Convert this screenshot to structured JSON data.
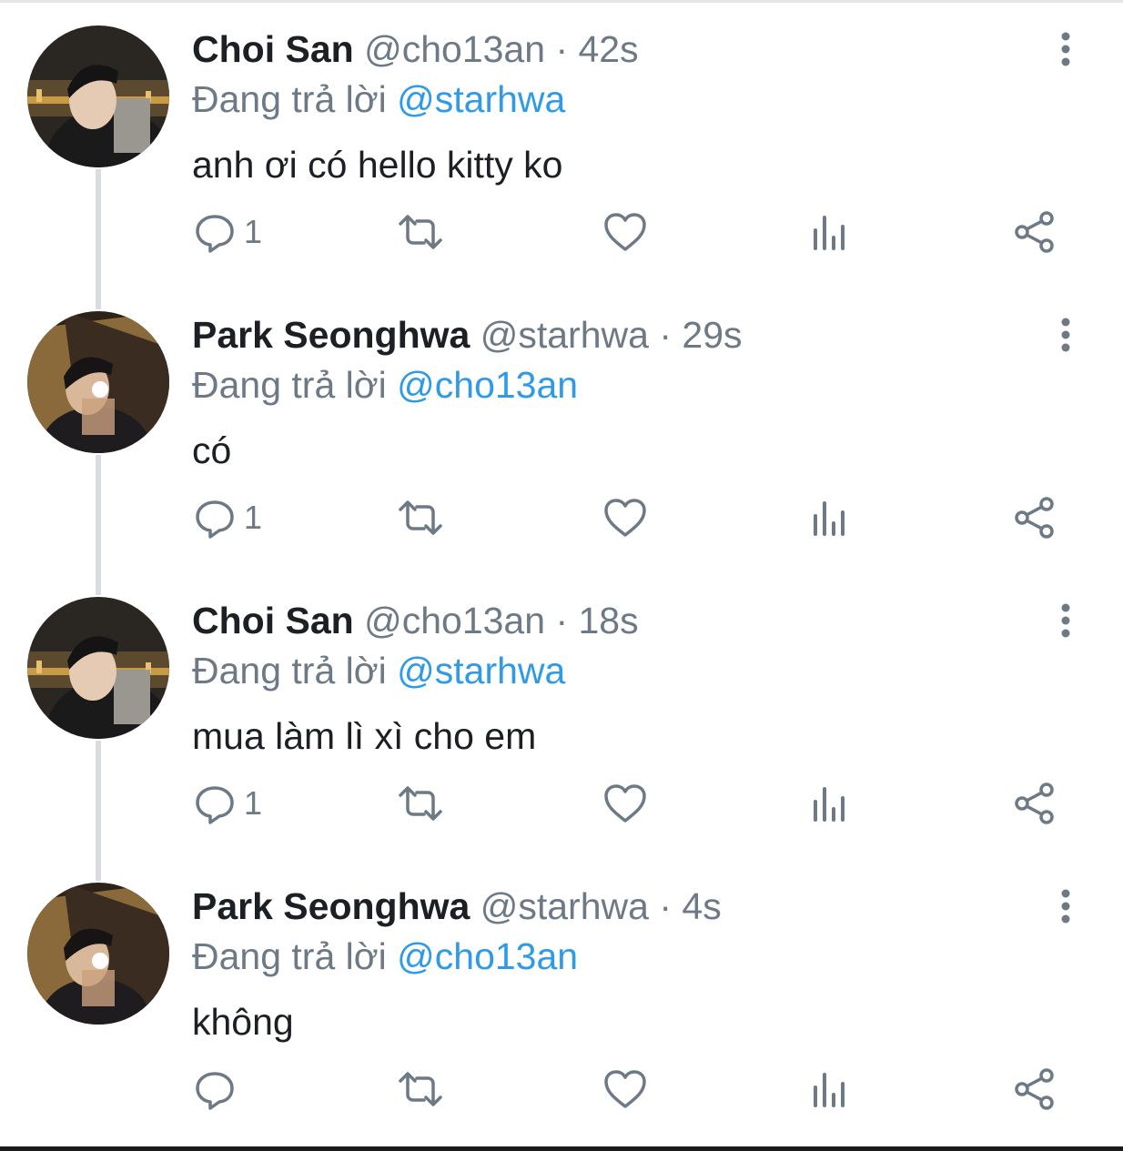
{
  "colors": {
    "text": "#1c1f23",
    "secondary": "#6d7a86",
    "link": "#2f9be6",
    "thread_line": "#d9dde1"
  },
  "icons": {
    "reply": "reply-icon",
    "retweet": "retweet-icon",
    "like": "like-icon",
    "views": "views-icon",
    "share": "share-icon",
    "more": "more-options-icon"
  },
  "tweets": [
    {
      "name": "Choi San",
      "handle": "@cho13an",
      "separator": "·",
      "time": "42s",
      "reply_prefix": "Đang trả lời",
      "reply_to": "@starhwa",
      "text": "anh ơi có hello kitty ko",
      "reply_count": "1"
    },
    {
      "name": "Park Seonghwa",
      "handle": "@starhwa",
      "separator": "·",
      "time": "29s",
      "reply_prefix": "Đang trả lời",
      "reply_to": "@cho13an",
      "text": "có",
      "reply_count": "1"
    },
    {
      "name": "Choi San",
      "handle": "@cho13an",
      "separator": "·",
      "time": "18s",
      "reply_prefix": "Đang trả lời",
      "reply_to": "@starhwa",
      "text": "mua làm lì xì cho em",
      "reply_count": "1"
    },
    {
      "name": "Park Seonghwa",
      "handle": "@starhwa",
      "separator": "·",
      "time": "4s",
      "reply_prefix": "Đang trả lời",
      "reply_to": "@cho13an",
      "text": "không",
      "reply_count": ""
    }
  ]
}
